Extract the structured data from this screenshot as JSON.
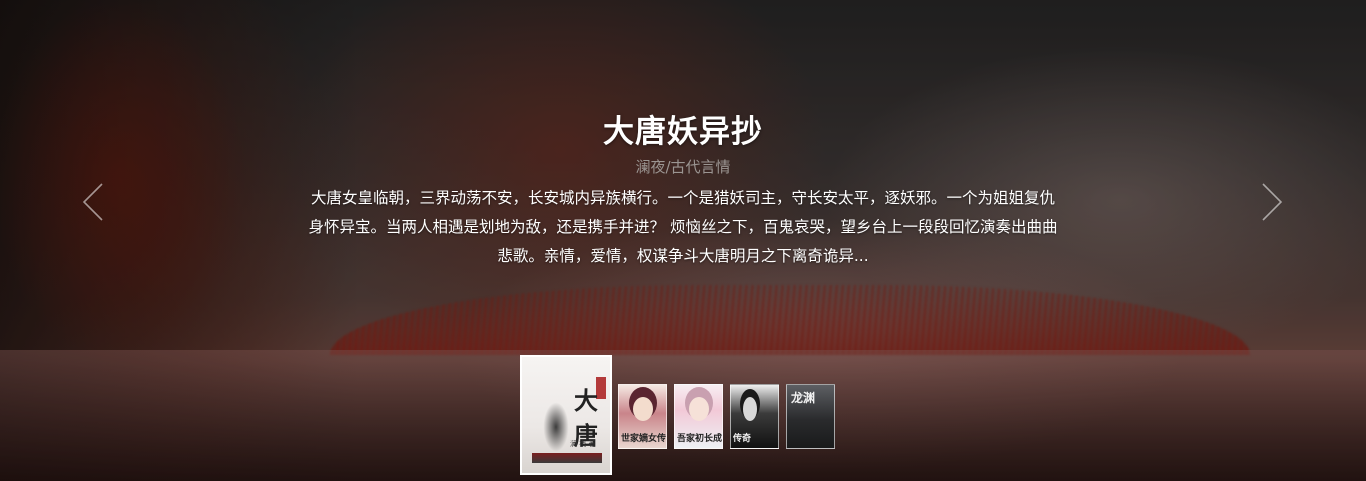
{
  "banner": {
    "title": "大唐妖异抄",
    "meta": "澜夜/古代言情",
    "description": "大唐女皇临朝，三界动荡不安，长安城内异族横行。一个是猎妖司主，守长安太平，逐妖邪。一个为姐姐复仇身怀异宝。当两人相遇是划地为敌，还是携手并进？ 烦恼丝之下，百鬼哀哭，望乡台上一段段回忆演奏出曲曲悲歌。亲情，爱情，权谋争斗大唐明月之下离奇诡异..."
  },
  "navigation": {
    "prev_icon": "chevron-left-icon",
    "next_icon": "chevron-right-icon"
  },
  "thumbnails": [
    {
      "cover_title": "大唐",
      "cover_author": "澜 夜 著",
      "active": true
    },
    {
      "cover_title": "世家嫡女传",
      "active": false
    },
    {
      "cover_title": "吾家初长成",
      "active": false
    },
    {
      "cover_title": "传奇",
      "active": false
    },
    {
      "cover_title": "龙渊",
      "active": false
    }
  ],
  "colors": {
    "title": "#ffffff",
    "meta": "#9b9592",
    "description": "#ffffff",
    "active_border": "#ffffff"
  }
}
